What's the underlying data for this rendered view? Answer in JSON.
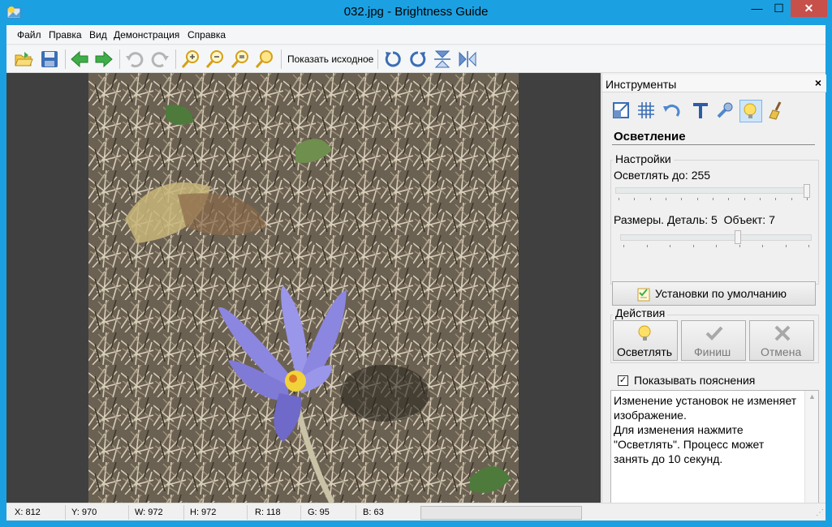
{
  "window": {
    "title": "032.jpg - Brightness Guide",
    "min_glyph": "—",
    "max_glyph": "☐",
    "close_glyph": "✕"
  },
  "menu": [
    "Файл",
    "Правка",
    "Вид",
    "Демонстрация",
    "Справка"
  ],
  "toolbar": {
    "show_original_label": "Показать исходное",
    "icons": [
      "open-folder-icon",
      "save-icon",
      "back-arrow-icon",
      "forward-arrow-icon",
      "undo-icon",
      "redo-icon",
      "zoom-in-icon",
      "zoom-out-icon",
      "zoom-fit-icon",
      "zoom-actual-icon",
      "rotate-left-icon",
      "rotate-right-icon",
      "flip-vertical-icon",
      "flip-horizontal-icon"
    ]
  },
  "panel": {
    "title": "Инструменты",
    "close_glyph": "×",
    "tools": [
      "crop-icon",
      "grid-icon",
      "undo-arrow-icon",
      "text-icon",
      "wrench-icon",
      "lightbulb-icon",
      "brush-icon"
    ],
    "active_tool": "lightbulb-icon",
    "section_title": "Осветление",
    "settings": {
      "group_label": "Настройки",
      "brighten_label": "Осветлять до:",
      "brighten_value": "255",
      "brighten_slider_fraction": 1.0,
      "sizes_label": "Размеры. Деталь:",
      "detail_value": "5",
      "object_label": "Объект:",
      "object_value": "7",
      "sizes_slider_fraction": 0.62,
      "defaults_button": "Установки по умолчанию"
    },
    "actions": {
      "group_label": "Действия",
      "brighten_button": "Осветлять",
      "finish_button": "Финиш",
      "cancel_button": "Отмена"
    },
    "show_hints_label": "Показывать пояснения",
    "show_hints_checked": true,
    "hint_text": "Изменение установок не изменяет изображение.\nДля изменения нажмите \"Осветлять\". Процесс может занять до 10 секунд."
  },
  "status": {
    "x": "X: 812",
    "y": "Y: 970",
    "w": "W: 972",
    "h": "H: 972",
    "r": "R: 118",
    "g": "G: 95",
    "b": "B: 63"
  },
  "colors": {
    "titlebar": "#1ba1e2",
    "viewer_bg": "#404040",
    "flower": "#8b86e0"
  }
}
